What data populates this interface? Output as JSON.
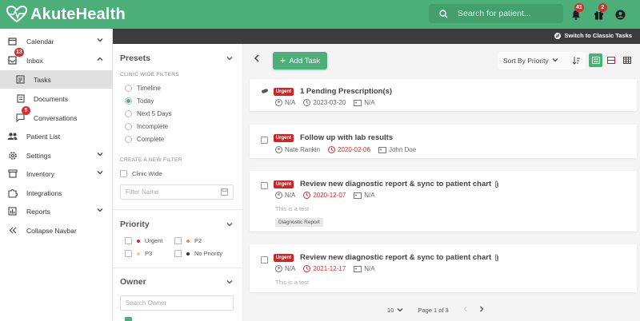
{
  "app": {
    "brand": "AkuteHealth",
    "search_placeholder": "Search for patient...",
    "notifications_count": "41",
    "gifts_count": "2",
    "switch_label": "Switch to Classic Tasks"
  },
  "sidebar": {
    "calendar": "Calendar",
    "inbox": "Inbox",
    "inbox_badge": "13",
    "tasks": "Tasks",
    "documents": "Documents",
    "conversations": "Conversations",
    "conversations_badge": "5",
    "patient_list": "Patient List",
    "settings": "Settings",
    "inventory": "Inventory",
    "integrations": "Integrations",
    "reports": "Reports",
    "collapse": "Collapse Navbar"
  },
  "filters": {
    "presets_title": "Presets",
    "clinic_wide_caption": "CLINIC WIDE FILTERS",
    "preset_options": [
      "Timeline",
      "Today",
      "Next 5 Days",
      "Incomplete",
      "Complete"
    ],
    "selected_preset": "Today",
    "create_caption": "CREATE A NEW FILTER",
    "clinic_wide_label": "Clinic Wide",
    "filter_name_placeholder": "Filter Name",
    "priority_title": "Priority",
    "priorities": [
      "Urgent",
      "P2",
      "P3",
      "No Priority"
    ],
    "priority_colors": [
      "#c62828",
      "#ef8a3c",
      "#f6c88a",
      "#333333"
    ],
    "owner_title": "Owner",
    "owner_placeholder": "Search Owner"
  },
  "toolbar": {
    "add_task": "Add Task",
    "sort_label": "Sort By Priority"
  },
  "tasks": [
    {
      "priority": "Urgent",
      "title": "1 Pending Prescription(s)",
      "owner": "N/A",
      "date": "2023-03-20",
      "assignee": "N/A"
    },
    {
      "priority": "Urgent",
      "title": "Follow up with lab results",
      "owner": "Nate Rankin",
      "date": "2020-02-06",
      "assignee": "John Doe"
    },
    {
      "priority": "Urgent",
      "title": "Review new diagnostic report & sync to patient chart",
      "owner": "N/A",
      "date": "2020-12-07",
      "assignee": "N/A",
      "description": "This is a test",
      "tag": "Diagnostic Report"
    },
    {
      "priority": "Urgent",
      "title": "Review new diagnostic report & sync to patient chart",
      "owner": "N/A",
      "date": "2021-12-17",
      "assignee": "N/A",
      "description": "This is a test"
    }
  ],
  "pagination": {
    "page_size": "10",
    "page_label": "Page 1 of 3"
  },
  "colors": {
    "brand_green": "#4caf7a",
    "urgent_red": "#c62828",
    "overdue_red": "#d32f2f"
  }
}
